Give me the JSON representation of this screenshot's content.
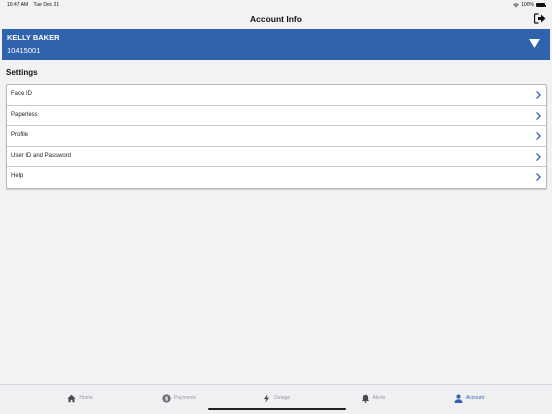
{
  "status_bar": {
    "time": "10:47 AM",
    "date": "Tue Dec 21",
    "battery": "100%"
  },
  "nav": {
    "title": "Account Info",
    "logout_icon": "logout-icon"
  },
  "account": {
    "name": "KELLY BAKER",
    "number": "10415001",
    "expand_icon": "chevron-down-icon"
  },
  "settings": {
    "title": "Settings",
    "items": [
      {
        "label": "Face ID"
      },
      {
        "label": "Paperless"
      },
      {
        "label": "Profile"
      },
      {
        "label": "User ID and Password"
      },
      {
        "label": "Help"
      }
    ]
  },
  "tabs": [
    {
      "label": "Home",
      "icon": "home-icon"
    },
    {
      "label": "Payments",
      "icon": "dollar-icon"
    },
    {
      "label": "Outage",
      "icon": "lightning-icon"
    },
    {
      "label": "Alerts",
      "icon": "bell-icon"
    },
    {
      "label": "Account",
      "icon": "person-icon",
      "active": true
    }
  ],
  "colors": {
    "accent": "#2f64ad",
    "background": "#f2f2f4",
    "tab_inactive": "#9a9aa0"
  }
}
